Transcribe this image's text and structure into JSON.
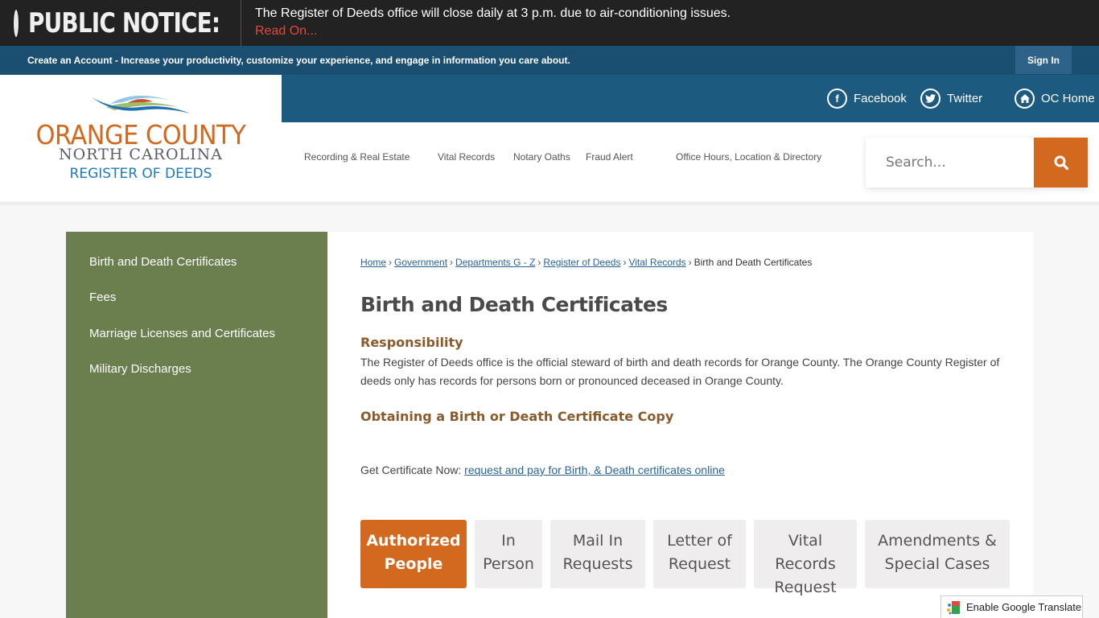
{
  "notice": {
    "title": "PUBLIC NOTICE:",
    "message": "The Register of Deeds office will close daily at 3 p.m. due to air-conditioning issues.",
    "link": "Read On..."
  },
  "account_bar": {
    "text": "Create an Account - Increase your productivity, customize your experience, and engage in information you care about.",
    "sign_in": "Sign In"
  },
  "logo": {
    "line1": "ORANGE COUNTY",
    "line2": "NORTH CAROLINA",
    "line3": "REGISTER OF DEEDS"
  },
  "social": [
    {
      "label": "Facebook",
      "icon": "facebook-icon"
    },
    {
      "label": "Twitter",
      "icon": "twitter-icon"
    },
    {
      "label": "OC Home",
      "icon": "home-icon"
    }
  ],
  "nav": [
    "Recording & Real Estate",
    "Vital Records",
    "Notary Oaths",
    "Fraud Alert",
    "Office Hours, Location & Directory"
  ],
  "search": {
    "placeholder": "Search...",
    "value": ""
  },
  "sidebar": {
    "items": [
      "Birth and Death Certificates",
      "Fees",
      "Marriage Licenses and Certificates",
      "Military Discharges"
    ]
  },
  "breadcrumb": {
    "links": [
      "Home",
      "Government",
      "Departments G - Z",
      "Register of Deeds",
      "Vital Records"
    ],
    "current": "Birth and Death Certificates"
  },
  "content": {
    "title": "Birth and Death Certificates",
    "responsibility_heading": "Responsibility",
    "responsibility_text": "The Register of Deeds office is the official steward of birth and death records for Orange County. The Orange County Register of deeds only has records for persons born or pronounced deceased in Orange County.",
    "obtain_heading": "Obtaining a Birth or Death Certificate Copy",
    "get_cert_label": "Get Certificate Now:",
    "get_cert_link": "request and pay for Birth, & Death certificates online"
  },
  "tabs": [
    {
      "line1": "Authorized",
      "line2": "People",
      "line3": "",
      "active": true
    },
    {
      "line1": "In",
      "line2": "Person",
      "line3": "",
      "active": false
    },
    {
      "line1": "Mail In",
      "line2": "Requests",
      "line3": "",
      "active": false
    },
    {
      "line1": "Letter of",
      "line2": "Request",
      "line3": "",
      "active": false
    },
    {
      "line1": "Vital",
      "line2": "Records",
      "line3": "Request",
      "active": false
    },
    {
      "line1": "Amendments &",
      "line2": "Special Cases",
      "line3": "",
      "active": false
    }
  ],
  "translate": {
    "label": "Enable Google Translate"
  },
  "colors": {
    "accent_orange": "#d2691e",
    "header_blue": "#1c5a80",
    "sidebar_green": "#6b7f4e",
    "notice_red": "#e0493a"
  }
}
